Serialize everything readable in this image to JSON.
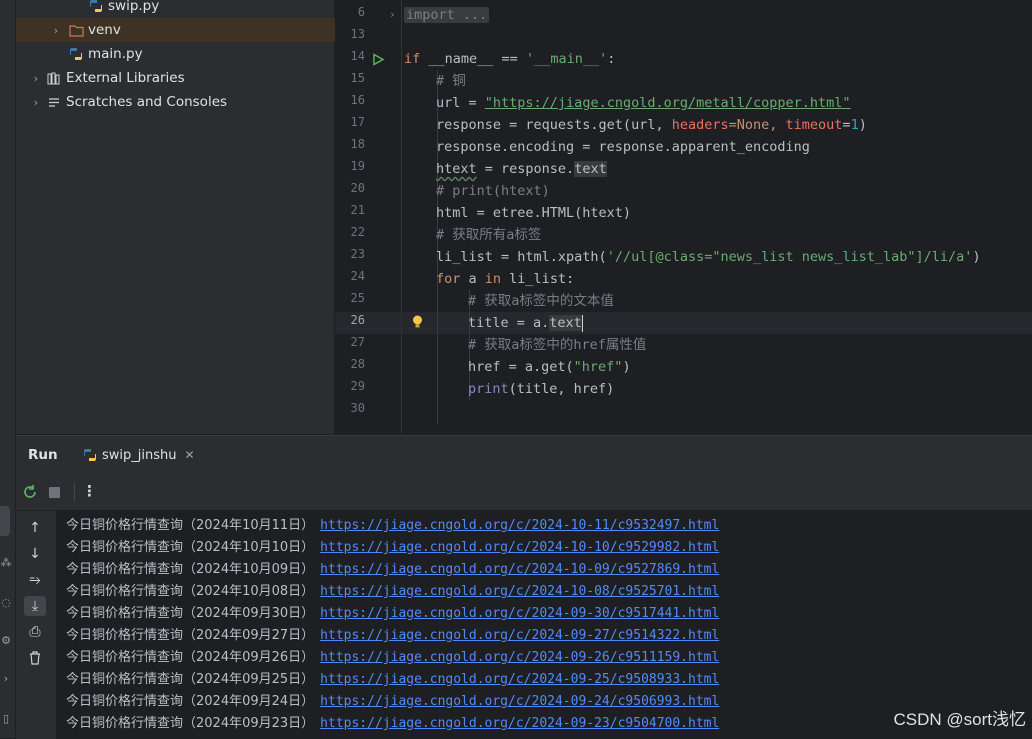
{
  "project_tree": {
    "items": [
      {
        "label": "swip.py",
        "type": "python-file"
      },
      {
        "label": "venv",
        "type": "folder"
      },
      {
        "label": "main.py",
        "type": "python-file"
      },
      {
        "label": "External Libraries",
        "type": "library"
      },
      {
        "label": "Scratches and Consoles",
        "type": "scratches"
      }
    ]
  },
  "editor": {
    "current_line_number": "26",
    "line_numbers": [
      "6",
      "13",
      "14",
      "15",
      "16",
      "17",
      "18",
      "19",
      "20",
      "21",
      "22",
      "23",
      "24",
      "25",
      "26",
      "27",
      "28",
      "29",
      "30"
    ],
    "fold_text": "import ...",
    "code": {
      "l14_if": "if",
      "l14_name": " __name__ == ",
      "l14_main": "'__main__'",
      "l14_colon": ":",
      "l15": "# 铜",
      "l16_a": "url = ",
      "l16_url": "\"https://jiage.cngold.org/metall/copper.html\"",
      "l17_a": "response = requests.get(url, ",
      "l17_headers": "headers",
      "l17_b": "=None, ",
      "l17_timeout": "timeout",
      "l17_c": "=",
      "l17_one": "1",
      "l17_d": ")",
      "l18": "response.encoding = response.apparent_encoding",
      "l19_var": "htext",
      "l19_a": " = response.",
      "l19_attr": "text",
      "l20": "# print(htext)",
      "l21": "html = etree.HTML(htext)",
      "l22": "# 获取所有a标签",
      "l23_a": "li_list = html.xpath(",
      "l23_str": "'//ul[@class=\"news_list news_list_lab\"]/li/a'",
      "l23_b": ")",
      "l24_for": "for",
      "l24_a": " a ",
      "l24_in": "in",
      "l24_b": " li_list:",
      "l25": "# 获取a标签中的文本值",
      "l26_a": "title = a.",
      "l26_attr": "text",
      "l27": "# 获取a标签中的href属性值",
      "l28_a": "href = a.get(",
      "l28_str": "\"href\"",
      "l28_b": ")",
      "l29_print": "print",
      "l29_a": "(title, href)"
    }
  },
  "run_panel": {
    "title": "Run",
    "tab_label": "swip_jinshu",
    "output": [
      {
        "text": "今日铜价格行情查询（2024年10月11日）",
        "url": "https://jiage.cngold.org/c/2024-10-11/c9532497.html"
      },
      {
        "text": "今日铜价格行情查询（2024年10月10日）",
        "url": "https://jiage.cngold.org/c/2024-10-10/c9529982.html"
      },
      {
        "text": "今日铜价格行情查询（2024年10月09日）",
        "url": "https://jiage.cngold.org/c/2024-10-09/c9527869.html"
      },
      {
        "text": "今日铜价格行情查询（2024年10月08日）",
        "url": "https://jiage.cngold.org/c/2024-10-08/c9525701.html"
      },
      {
        "text": "今日铜价格行情查询（2024年09月30日）",
        "url": "https://jiage.cngold.org/c/2024-09-30/c9517441.html"
      },
      {
        "text": "今日铜价格行情查询（2024年09月27日）",
        "url": "https://jiage.cngold.org/c/2024-09-27/c9514322.html"
      },
      {
        "text": "今日铜价格行情查询（2024年09月26日）",
        "url": "https://jiage.cngold.org/c/2024-09-26/c9511159.html"
      },
      {
        "text": "今日铜价格行情查询（2024年09月25日）",
        "url": "https://jiage.cngold.org/c/2024-09-25/c9508933.html"
      },
      {
        "text": "今日铜价格行情查询（2024年09月24日）",
        "url": "https://jiage.cngold.org/c/2024-09-24/c9506993.html"
      },
      {
        "text": "今日铜价格行情查询（2024年09月23日）",
        "url": "https://jiage.cngold.org/c/2024-09-23/c9504700.html"
      }
    ]
  },
  "watermark": "CSDN @sort浅忆",
  "colors": {
    "keyword": "#cf8e6d",
    "string": "#6aab73",
    "comment": "#7a7e85",
    "param": "#ee6f5b",
    "number": "#2aacb8",
    "link": "#548af7",
    "run_green": "#5fb865"
  }
}
